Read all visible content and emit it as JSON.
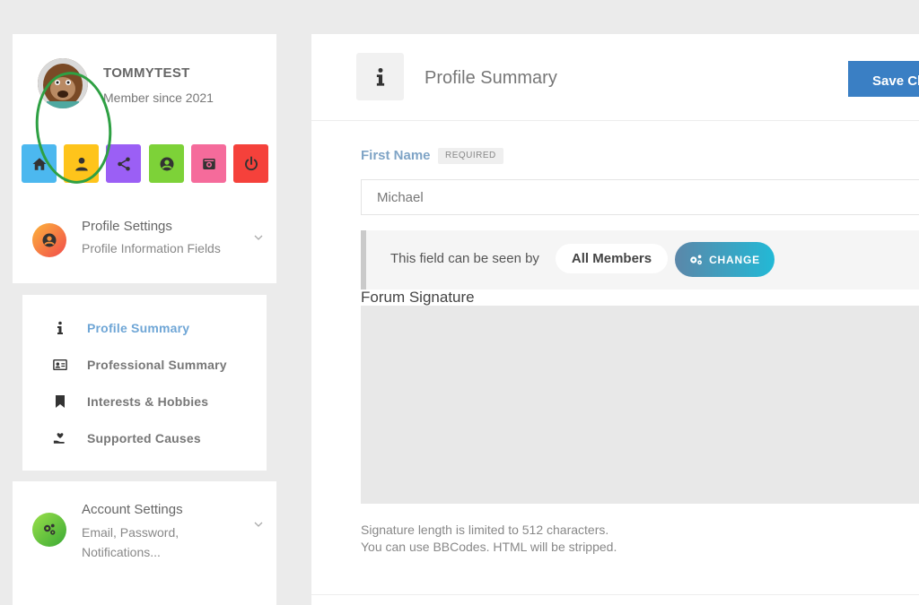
{
  "user": {
    "name": "TOMMYTEST",
    "member_since": "Member since 2021"
  },
  "nav_tiles": [
    {
      "icon": "home-icon",
      "color": "#4cb8ef"
    },
    {
      "icon": "user-icon",
      "color": "#fec41b"
    },
    {
      "icon": "share-icon",
      "color": "#9b5ff5"
    },
    {
      "icon": "user-circle-icon",
      "color": "#7dd238"
    },
    {
      "icon": "camera-icon",
      "color": "#f56b9b"
    },
    {
      "icon": "power-icon",
      "color": "#f5413b"
    }
  ],
  "sidebar": {
    "profile_settings": {
      "title": "Profile Settings",
      "subtitle": "Profile Information Fields"
    },
    "submenu": [
      {
        "label": "Profile Summary",
        "icon": "info-icon",
        "active": true
      },
      {
        "label": "Professional Summary",
        "icon": "id-card-icon",
        "active": false
      },
      {
        "label": "Interests & Hobbies",
        "icon": "bookmark-icon",
        "active": false
      },
      {
        "label": "Supported Causes",
        "icon": "hand-heart-icon",
        "active": false
      }
    ],
    "account_settings": {
      "title": "Account Settings",
      "subtitle": "Email, Password, Notifications..."
    }
  },
  "main": {
    "title": "Profile Summary",
    "save_label": "Save Ch",
    "first_name": {
      "label": "First Name",
      "badge": "REQUIRED",
      "value": "Michael"
    },
    "visibility": {
      "text": "This field can be seen by",
      "audience": "All Members",
      "change_label": "CHANGE"
    },
    "signature": {
      "label": "Forum Signature",
      "value": "",
      "hint_1": "Signature length is limited to 512 characters.",
      "hint_2": "You can use BBCodes. HTML will be stripped."
    }
  },
  "colors": {
    "accent_blue": "#3a7fc4",
    "active_link": "#6fa6d6",
    "highlight_ring": "#2ea043"
  }
}
